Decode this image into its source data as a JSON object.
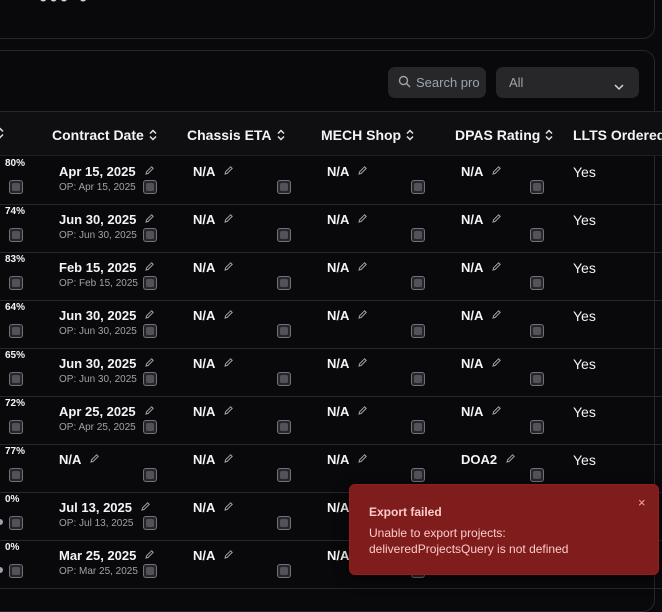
{
  "top_partial_text": "••• •",
  "search": {
    "placeholder": "Search pro"
  },
  "filter": {
    "selected": "All"
  },
  "columns": [
    {
      "label": "Contract Date"
    },
    {
      "label": "Chassis ETA"
    },
    {
      "label": "MECH Shop"
    },
    {
      "label": "DPAS Rating"
    },
    {
      "label": "LLTS Ordered"
    }
  ],
  "rows": [
    {
      "pct": "80%",
      "contract": "Apr 15, 2025",
      "op": "OP: Apr 15, 2025",
      "chassis": "N/A",
      "mech": "N/A",
      "dpas": "N/A",
      "llts": "Yes"
    },
    {
      "pct": "74%",
      "contract": "Jun 30, 2025",
      "op": "OP: Jun 30, 2025",
      "chassis": "N/A",
      "mech": "N/A",
      "dpas": "N/A",
      "llts": "Yes"
    },
    {
      "pct": "83%",
      "contract": "Feb 15, 2025",
      "op": "OP: Feb 15, 2025",
      "chassis": "N/A",
      "mech": "N/A",
      "dpas": "N/A",
      "llts": "Yes"
    },
    {
      "pct": "64%",
      "contract": "Jun 30, 2025",
      "op": "OP: Jun 30, 2025",
      "chassis": "N/A",
      "mech": "N/A",
      "dpas": "N/A",
      "llts": "Yes"
    },
    {
      "pct": "65%",
      "contract": "Jun 30, 2025",
      "op": "OP: Jun 30, 2025",
      "chassis": "N/A",
      "mech": "N/A",
      "dpas": "N/A",
      "llts": "Yes"
    },
    {
      "pct": "72%",
      "contract": "Apr 25, 2025",
      "op": "OP: Apr 25, 2025",
      "chassis": "N/A",
      "mech": "N/A",
      "dpas": "N/A",
      "llts": "Yes"
    },
    {
      "pct": "77%",
      "contract": "N/A",
      "op": "",
      "chassis": "N/A",
      "mech": "N/A",
      "dpas": "DOA2",
      "llts": "Yes"
    },
    {
      "pct": "0%",
      "contract": "Jul 13, 2025",
      "op": "OP: Jul 13, 2025",
      "chassis": "N/A",
      "mech": "N/A",
      "dpas": "",
      "llts": ""
    },
    {
      "pct": "0%",
      "contract": "Mar 25, 2025",
      "op": "OP: Mar 25, 2025",
      "chassis": "N/A",
      "mech": "N/A",
      "dpas": "",
      "llts": ""
    }
  ],
  "toast": {
    "title": "Export failed",
    "message": "Unable to export projects: deliveredProjectsQuery is not defined",
    "close": "×"
  }
}
